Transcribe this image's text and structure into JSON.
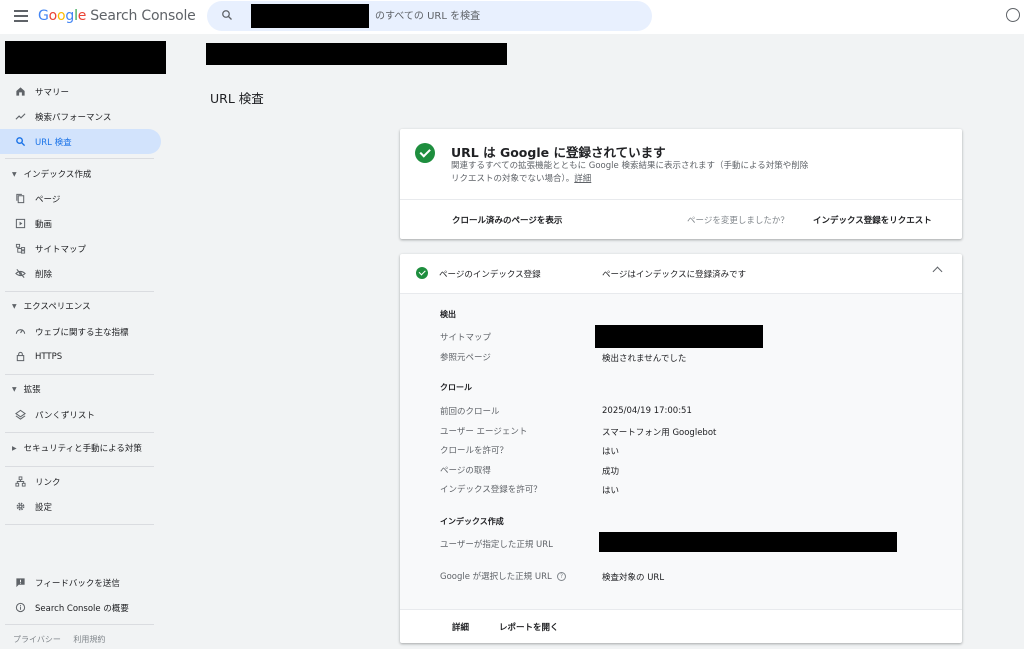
{
  "header": {
    "logo_google": [
      "G",
      "o",
      "o",
      "g",
      "l",
      "e"
    ],
    "logo_product": "Search Console",
    "search_placeholder": "のすべての URL を検査"
  },
  "sidebar": {
    "items": [
      {
        "label": "サマリー",
        "icon": "home-icon"
      },
      {
        "label": "検索パフォーマンス",
        "icon": "trending-up-icon"
      },
      {
        "label": "URL 検査",
        "icon": "search-icon",
        "active": true
      }
    ],
    "sections": [
      {
        "title": "インデックス作成",
        "items": [
          {
            "label": "ページ",
            "icon": "pages-icon"
          },
          {
            "label": "動画",
            "icon": "video-icon"
          },
          {
            "label": "サイトマップ",
            "icon": "sitemap-icon"
          },
          {
            "label": "削除",
            "icon": "eye-off-icon"
          }
        ]
      },
      {
        "title": "エクスペリエンス",
        "items": [
          {
            "label": "ウェブに関する主な指標",
            "icon": "speed-icon"
          },
          {
            "label": "HTTPS",
            "icon": "lock-icon"
          }
        ]
      },
      {
        "title": "拡張",
        "items": [
          {
            "label": "パンくずリスト",
            "icon": "layers-icon"
          }
        ]
      },
      {
        "title": "セキュリティと手動による対策",
        "items": []
      }
    ],
    "bottom_items": [
      {
        "label": "リンク",
        "icon": "links-icon"
      },
      {
        "label": "設定",
        "icon": "gear-icon"
      }
    ],
    "footer_items": [
      {
        "label": "フィードバックを送信",
        "icon": "feedback-icon"
      },
      {
        "label": "Search Console の概要",
        "icon": "info-icon"
      }
    ],
    "footer_links": [
      "プライバシー",
      "利用規約"
    ]
  },
  "main": {
    "title": "URL 検査",
    "status_card": {
      "title": "URL は Google に登録されています",
      "description": "関連するすべての拡張機能とともに Google 検索結果に表示されます（手動による対策や削除リクエストの対象でない場合）。",
      "details_link": "詳細",
      "view_crawled": "クロール済みのページを表示",
      "changed_prompt": "ページを変更しましたか？",
      "request_indexing": "インデックス登録をリクエスト"
    },
    "index_card": {
      "header_label": "ページのインデックス登録",
      "header_value": "ページはインデックスに登録済みです",
      "discovery": {
        "title": "検出",
        "sitemap_label": "サイトマップ",
        "referrer_label": "参照元ページ",
        "referrer_value": "検出されませんでした"
      },
      "crawl": {
        "title": "クロール",
        "last_crawl_label": "前回のクロール",
        "last_crawl_value": "2025/04/19 17:00:51",
        "user_agent_label": "ユーザー エージェント",
        "user_agent_value": "スマートフォン用 Googlebot",
        "crawl_allowed_label": "クロールを許可？",
        "crawl_allowed_value": "はい",
        "page_fetch_label": "ページの取得",
        "page_fetch_value": "成功",
        "indexing_allowed_label": "インデックス登録を許可？",
        "indexing_allowed_value": "はい"
      },
      "indexing": {
        "title": "インデックス作成",
        "user_canonical_label": "ユーザーが指定した正規 URL",
        "google_canonical_label": "Google が選択した正規 URL",
        "google_canonical_value": "検査対象の URL"
      },
      "footer_details": "詳細",
      "footer_open_report": "レポートを開く"
    }
  }
}
